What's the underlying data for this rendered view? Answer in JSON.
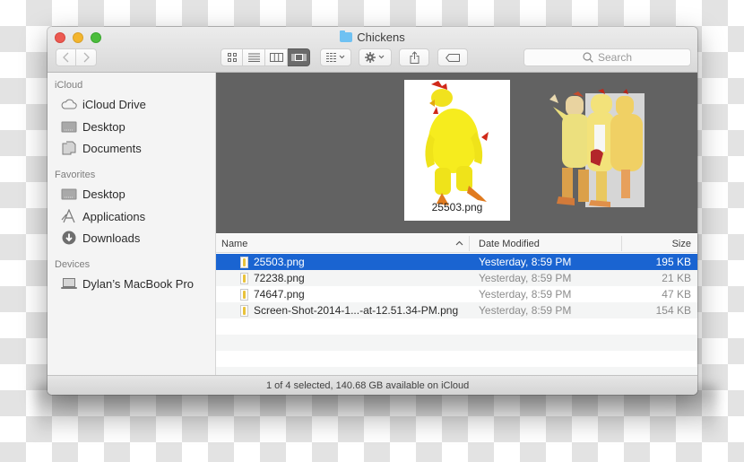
{
  "window": {
    "title": "Chickens",
    "folder_icon": "folder-icon"
  },
  "toolbar": {
    "back_icon": "chevron-left-icon",
    "forward_icon": "chevron-right-icon",
    "view_modes": [
      {
        "name": "icon-view",
        "icon": "grid-icon",
        "active": false
      },
      {
        "name": "list-view",
        "icon": "list-icon",
        "active": false
      },
      {
        "name": "column-view",
        "icon": "columns-icon",
        "active": false
      },
      {
        "name": "cover-flow-view",
        "icon": "coverflow-icon",
        "active": true
      }
    ],
    "arrange_icon": "arrange-icon",
    "action_icon": "gear-icon",
    "share_icon": "share-icon",
    "tag_icon": "tag-icon",
    "search_placeholder": "Search"
  },
  "sidebar": {
    "sections": [
      {
        "heading": "iCloud",
        "items": [
          {
            "label": "iCloud Drive",
            "icon": "cloud-icon"
          },
          {
            "label": "Desktop",
            "icon": "desktop-icon"
          },
          {
            "label": "Documents",
            "icon": "documents-icon"
          }
        ]
      },
      {
        "heading": "Favorites",
        "items": [
          {
            "label": "Desktop",
            "icon": "desktop-icon"
          },
          {
            "label": "Applications",
            "icon": "applications-icon"
          },
          {
            "label": "Downloads",
            "icon": "downloads-icon"
          }
        ]
      },
      {
        "heading": "Devices",
        "items": [
          {
            "label": "Dylan’s MacBook Pro",
            "icon": "laptop-icon"
          }
        ]
      }
    ]
  },
  "preview": {
    "caption": "25503.png"
  },
  "list": {
    "columns": {
      "name": "Name",
      "date": "Date Modified",
      "size": "Size"
    },
    "rows": [
      {
        "name": "25503.png",
        "date": "Yesterday, 8:59 PM",
        "size": "195 KB",
        "selected": true
      },
      {
        "name": "72238.png",
        "date": "Yesterday, 8:59 PM",
        "size": "21 KB",
        "selected": false
      },
      {
        "name": "74647.png",
        "date": "Yesterday, 8:59 PM",
        "size": "47 KB",
        "selected": false
      },
      {
        "name": "Screen-Shot-2014-1...-at-12.51.34-PM.png",
        "date": "Yesterday, 8:59 PM",
        "size": "154 KB",
        "selected": false
      }
    ]
  },
  "status": {
    "text": "1 of 4 selected, 140.68 GB available on iCloud"
  },
  "colors": {
    "selection": "#1a64d1",
    "preview_bg": "#626262",
    "close": "#ec5a52",
    "minimize": "#f3b52d",
    "zoom": "#4cbd3c"
  }
}
